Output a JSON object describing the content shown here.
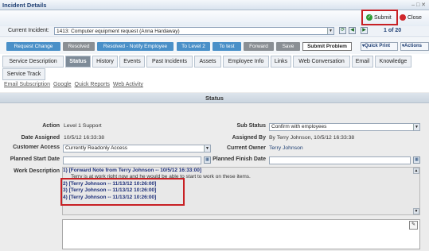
{
  "window": {
    "title": "Incident Details",
    "controls": [
      "–",
      "□",
      "✕"
    ]
  },
  "toolbar": {
    "submit_label": "Submit",
    "close_label": "Close"
  },
  "incident": {
    "label": "Current Incident:",
    "value": "1413: Computer equipment request (Anna Hardaway)",
    "page": "1 of 20"
  },
  "actions": {
    "buttons": [
      "Request Change",
      "Resolved",
      "Resolved - Notify Employee",
      "To Level 2",
      "To test",
      "Forward",
      "Save",
      "Submit Problem"
    ],
    "quick_print": "Quick Print",
    "actions_menu": "Actions"
  },
  "tabs": {
    "row1": [
      "Service Description",
      "Status",
      "History",
      "Events",
      "Past Incidents",
      "Assets",
      "Employee Info",
      "Links",
      "Web Conversation",
      "Email",
      "Knowledge"
    ],
    "row2": [
      "Service Track"
    ]
  },
  "sublinks": [
    "Email Subscription",
    "Google",
    "Quick Reports",
    "Web Activity"
  ],
  "status": {
    "heading": "Status",
    "action_label": "Action",
    "action_value": "Level 1 Support",
    "date_assigned_label": "Date Assigned",
    "date_assigned_value": "10/5/12 16:33:38",
    "customer_access_label": "Customer Access",
    "customer_access_value": "Currently Readonly Access",
    "planned_start_label": "Planned Start Date",
    "planned_start_value": "",
    "work_description_label": "Work Description",
    "sub_status_label": "Sub Status",
    "sub_status_value": "Confirm with employees",
    "assigned_by_label": "Assigned By",
    "assigned_by_value": "By Terry Johnson, 10/5/12 16:33:38",
    "current_owner_label": "Current Owner",
    "current_owner_value": "Terry Johnson",
    "planned_finish_label": "Planned Finish Date",
    "planned_finish_value": ""
  },
  "work_notes": [
    {
      "header": "1) [Forward Note from Terry Johnson -- 10/5/12 16:33:00]",
      "body": "Terry is at work right now and he would be able to start to work on these items."
    },
    {
      "header": "2) [Terry Johnson -- 11/13/12 10:26:00]",
      "body": ""
    },
    {
      "header": "3) [Terry Johnson -- 11/13/12 10:26:00]",
      "body": ""
    },
    {
      "header": "4) [Terry Johnson -- 11/13/12 10:26:00]",
      "body": ""
    }
  ],
  "colors": {
    "highlight": "#c82024",
    "accent_blue": "#4a90c8",
    "title_blue": "#1f3f73",
    "submit_green": "#2e9b36",
    "close_red": "#d0272b"
  }
}
